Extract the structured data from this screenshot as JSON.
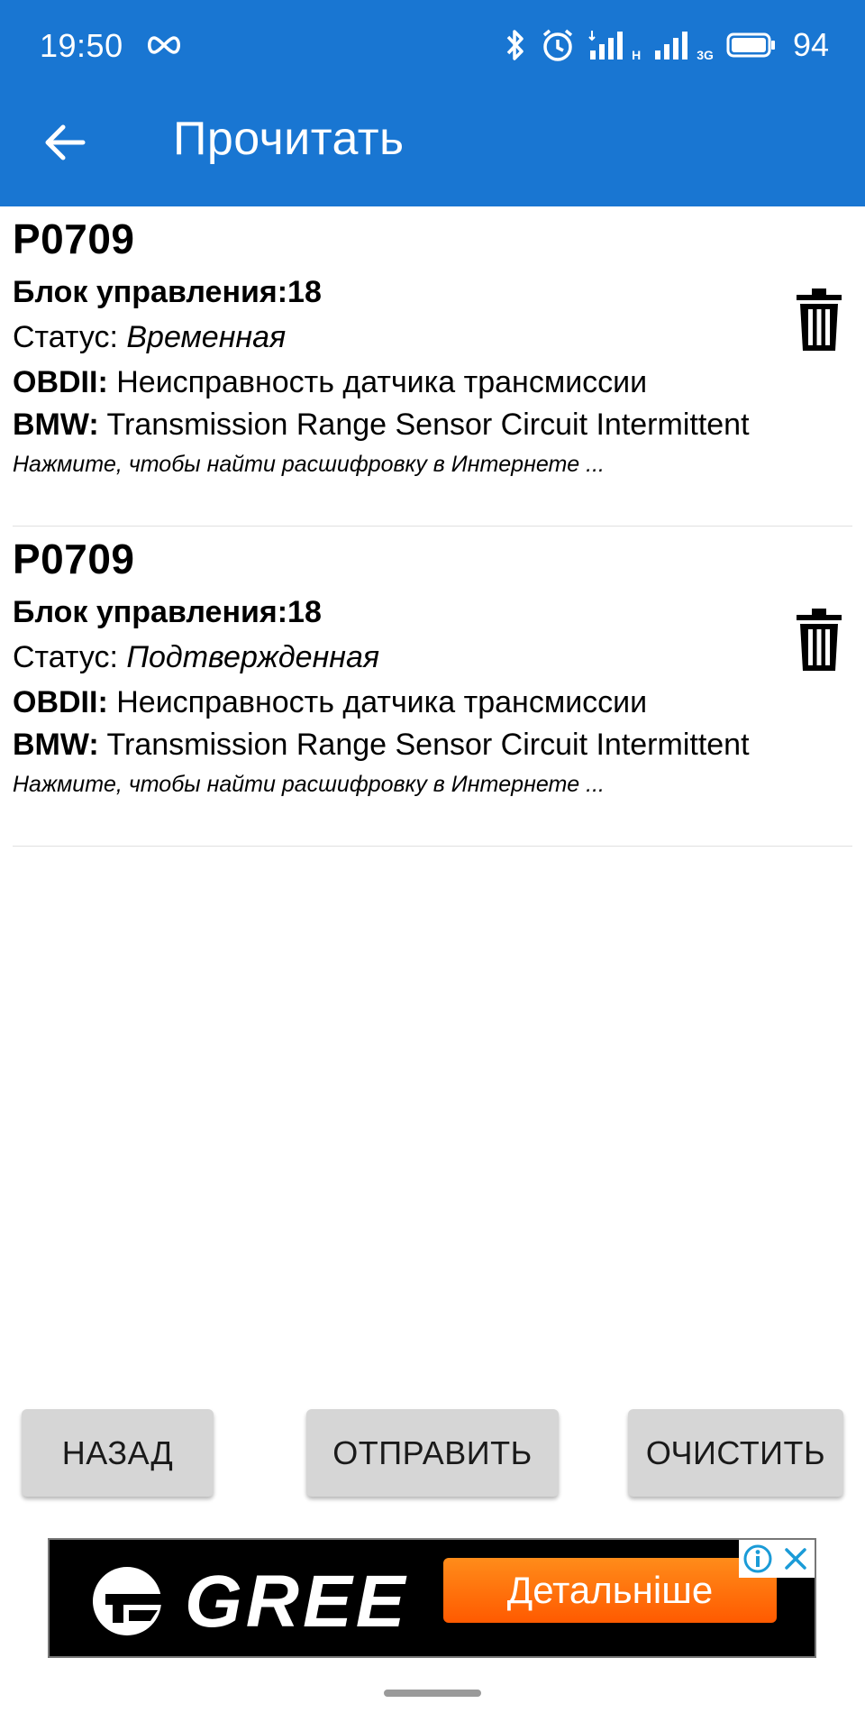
{
  "status_bar": {
    "time": "19:50",
    "net_label": "H",
    "net2_label": "3G",
    "battery": "94"
  },
  "app_bar": {
    "title": "Прочитать"
  },
  "errors": [
    {
      "code": "P0709",
      "block_label": "Блок управления:18",
      "status_prefix": "Статус: ",
      "status_value": "Временная",
      "obd_label": "OBDII:",
      "obd_text": " Неисправность датчика трансмиссии",
      "bmw_label": "BMW:",
      "bmw_text": " Transmission Range Sensor Circuit Intermittent",
      "hint": "Нажмите, чтобы найти расшифровку в Интернете ..."
    },
    {
      "code": "P0709",
      "block_label": "Блок управления:18",
      "status_prefix": "Статус: ",
      "status_value": "Подтвержденная",
      "obd_label": "OBDII:",
      "obd_text": " Неисправность датчика трансмиссии",
      "bmw_label": "BMW:",
      "bmw_text": " Transmission Range Sensor Circuit Intermittent",
      "hint": "Нажмите, чтобы найти расшифровку в Интернете ..."
    }
  ],
  "buttons": {
    "back": "НАЗАД",
    "send": "ОТПРАВИТЬ",
    "clear": "ОЧИСТИТЬ"
  },
  "ad": {
    "brand": "GREE",
    "cta": "Детальніше"
  },
  "colors": {
    "app_bar": "#1976d2",
    "button_bg": "#d6d6d6",
    "ad_cta": "#ff6a00"
  }
}
